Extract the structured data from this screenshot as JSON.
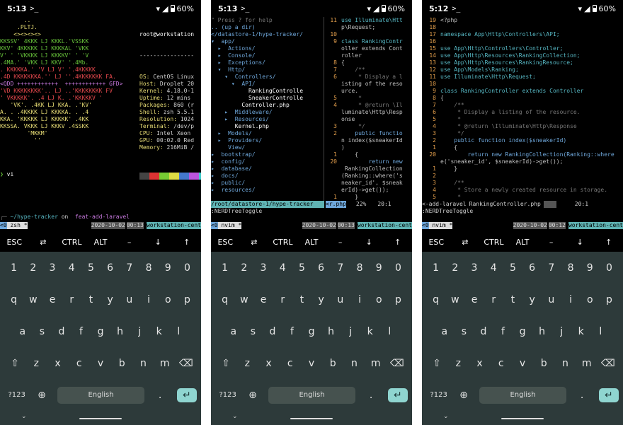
{
  "status_bar": [
    {
      "time": "5:13",
      "prompt_icon": ">_",
      "battery": "60%"
    },
    {
      "time": "5:13",
      "prompt_icon": ">_",
      "battery": "60%"
    },
    {
      "time": "5:12",
      "prompt_icon": ">_",
      "battery": "60%"
    }
  ],
  "screen1": {
    "art": [
      "       ..",
      "     .PLTJ.",
      "    <><><><>",
      "KKSSV' 4KKK LJ KKKL.'VSSKK",
      "KKV' 4KKKKK LJ KKKKAL 'VKK",
      "V' ' 'VKKKK LJ KKKKV' ' 'V",
      ".4MA.' 'VKK LJ KKV' '.4Mb.",
      ". KKKKKA.' 'V LJ V' '.4KKKKK .",
      ".4D KKKKKKKA.'' LJ ''.4KKKKKKK FA.",
      "<QDD ++++++++++++  ++++++++++++ GFD>",
      "'VD KKKKKKKK'.. LJ ..'KKKKKKKK FV",
      "' VKKKKK'. .4 LJ K. .'KKKKKV '",
      "   'VK'. .4KK LJ KKA. .'KV'",
      "A. . .4KKKK LJ KKKKA. . .4",
      "KKA. 'KKKKK LJ KKKKK' .4KK",
      "KKSSA. VKKK LJ KKKV .4SSKK",
      "        'MKKM'",
      "          ''"
    ],
    "sysinfo_title": "root@workstation",
    "sysinfo_sep": "----------------",
    "sysinfo": [
      {
        "k": "OS:",
        "v": " CentOS Linux"
      },
      {
        "k": "Host:",
        "v": " Droplet 20"
      },
      {
        "k": "Kernel:",
        "v": " 4.18.0-1"
      },
      {
        "k": "Uptime:",
        "v": " 12 mins"
      },
      {
        "k": "Packages:",
        "v": " 860 (r"
      },
      {
        "k": "Shell:",
        "v": " zsh 5.5.1"
      },
      {
        "k": "Resolution:",
        "v": " 1024"
      },
      {
        "k": "Terminal:",
        "v": " /dev/p"
      },
      {
        "k": "CPU:",
        "v": " Intel Xeon"
      },
      {
        "k": "GPU:",
        "v": " 00:02.0 Red"
      },
      {
        "k": "Memory:",
        "v": " 216MiB /"
      }
    ],
    "cmd1": "vi",
    "path": "~/hype-tracker",
    "on": " on ",
    "branch": " feat-add-laravel",
    "prompt_arrow": "❯",
    "tmux": {
      "idx": "<0",
      "win": " zsh *",
      "date": "2020-10-02",
      "time": "00:13",
      "host": "workstation-cent"
    }
  },
  "screen2": {
    "tree": [
      {
        "t": "\" Press ? for help",
        "c": "dim"
      },
      {
        "t": "",
        "c": ""
      },
      {
        "t": ".. (up a dir)",
        "c": "blu"
      },
      {
        "t": "</datastore-1/hype-tracker/",
        "c": "blu"
      },
      {
        "t": "▾  app/",
        "c": "blu"
      },
      {
        "t": "  ▸  Actions/",
        "c": "blu"
      },
      {
        "t": "  ▸  Console/",
        "c": "blu"
      },
      {
        "t": "  ▸  Exceptions/",
        "c": "blu"
      },
      {
        "t": "  ▾  Http/",
        "c": "blu"
      },
      {
        "t": "    ▾  Controllers/",
        "c": "blu"
      },
      {
        "t": "      ▾  API/",
        "c": "blu"
      },
      {
        "t": "           RankingControlle",
        "c": "wht"
      },
      {
        "t": "           SneakerControlle",
        "c": "wht"
      },
      {
        "t": "         Controller.php",
        "c": "wht"
      },
      {
        "t": "    ▸  Middleware/",
        "c": "blu"
      },
      {
        "t": "    ▸  Resources/",
        "c": "blu"
      },
      {
        "t": "       Kernel.php",
        "c": "wht"
      },
      {
        "t": "  ▸  Models/",
        "c": "blu"
      },
      {
        "t": "  ▸  Providers/",
        "c": "blu"
      },
      {
        "t": "     View/",
        "c": "blu"
      },
      {
        "t": "▸  bootstrap/",
        "c": "blu"
      },
      {
        "t": "▸  config/",
        "c": "blu"
      },
      {
        "t": "▸  database/",
        "c": "blu"
      },
      {
        "t": "▸  docs/",
        "c": "blu"
      },
      {
        "t": "▸  public/",
        "c": "blu"
      },
      {
        "t": "▸  resources/",
        "c": "blu"
      }
    ],
    "code": [
      {
        "n": "11",
        "t": "use Illuminate\\Htt"
      },
      {
        "n": "",
        "t": "p\\Request;"
      },
      {
        "n": "10",
        "t": ""
      },
      {
        "n": "9",
        "t": "class RankingContr"
      },
      {
        "n": "",
        "t": "oller extends Cont"
      },
      {
        "n": "",
        "t": "roller"
      },
      {
        "n": "8",
        "t": "{"
      },
      {
        "n": "7",
        "t": "    /**"
      },
      {
        "n": "6",
        "t": "     * Display a l"
      },
      {
        "n": "",
        "t": "isting of the reso"
      },
      {
        "n": "",
        "t": "urce."
      },
      {
        "n": "5",
        "t": "     *"
      },
      {
        "n": "4",
        "t": "     * @return \\Il"
      },
      {
        "n": "",
        "t": "luminate\\Http\\Resp"
      },
      {
        "n": "",
        "t": "onse"
      },
      {
        "n": "3",
        "t": "     */"
      },
      {
        "n": "2",
        "t": "    public functio"
      },
      {
        "n": "",
        "t": "n index($sneakerId"
      },
      {
        "n": "",
        "t": ")"
      },
      {
        "n": "1",
        "t": "    {"
      },
      {
        "n": "20",
        "t": "        return new"
      },
      {
        "n": "",
        "t": " RankingCollection"
      },
      {
        "n": "",
        "t": "(Ranking::where('s"
      },
      {
        "n": "",
        "t": "neaker_id', $sneak"
      },
      {
        "n": "",
        "t": "erId)->get());"
      },
      {
        "n": "1",
        "t": "    }"
      }
    ],
    "status_left": "/root/datastore-1/hype-tracker",
    "status_right": "<r.php",
    "status_pct": "22%",
    "status_pos": "20:1",
    "cmdline": ":NERDTreeToggle",
    "tmux": {
      "idx": "<0",
      "win": " nvim *",
      "date": "2020-10-02",
      "time": "00:13",
      "host": "workstation-cent"
    }
  },
  "screen3": {
    "code": [
      {
        "n": "19",
        "t": "<?php"
      },
      {
        "n": "18",
        "t": ""
      },
      {
        "n": "17",
        "t": "namespace App\\Http\\Controllers\\API;"
      },
      {
        "n": "16",
        "t": ""
      },
      {
        "n": "15",
        "t": "use App\\Http\\Controllers\\Controller;"
      },
      {
        "n": "14",
        "t": "use App\\Http\\Resources\\RankingCollection;"
      },
      {
        "n": "13",
        "t": "use App\\Http\\Resources\\RankingResource;"
      },
      {
        "n": "12",
        "t": "use App\\Models\\Ranking;"
      },
      {
        "n": "11",
        "t": "use Illuminate\\Http\\Request;"
      },
      {
        "n": "10",
        "t": ""
      },
      {
        "n": "9",
        "t": "class RankingController extends Controller"
      },
      {
        "n": "8",
        "t": "{"
      },
      {
        "n": "7",
        "t": "    /**"
      },
      {
        "n": "6",
        "t": "     * Display a listing of the resource."
      },
      {
        "n": "5",
        "t": "     *"
      },
      {
        "n": "4",
        "t": "     * @return \\Illuminate\\Http\\Response"
      },
      {
        "n": "3",
        "t": "     */"
      },
      {
        "n": "2",
        "t": "    public function index($sneakerId)"
      },
      {
        "n": "1",
        "t": "    {"
      },
      {
        "n": "20",
        "t": "        return new RankingCollection(Ranking::where"
      },
      {
        "n": "",
        "t": "e('sneaker_id', $sneakerId)->get());"
      },
      {
        "n": "1",
        "t": "    }"
      },
      {
        "n": "2",
        "t": ""
      },
      {
        "n": "3",
        "t": "    /**"
      },
      {
        "n": "4",
        "t": "     * Store a newly created resource in storage."
      },
      {
        "n": "5",
        "t": "     *"
      }
    ],
    "status_left": "<-add-laravel",
    "status_file": "RankingController.php",
    "status_pos": "20:1",
    "cmdline": ":NERDTreeToggle",
    "tmux": {
      "idx": "<0",
      "win": " nvim *",
      "date": "2020-10-02",
      "time": "00:12",
      "host": "workstation-cent"
    }
  },
  "extra_keys": [
    "ESC",
    "⇄",
    "CTRL",
    "ALT",
    "–",
    "↓",
    "↑"
  ],
  "keyboard": {
    "numbers": [
      "1",
      "2",
      "3",
      "4",
      "5",
      "6",
      "7",
      "8",
      "9",
      "0"
    ],
    "row1": [
      "q",
      "w",
      "e",
      "r",
      "t",
      "y",
      "u",
      "i",
      "o",
      "p"
    ],
    "row2": [
      "a",
      "s",
      "d",
      "f",
      "g",
      "h",
      "j",
      "k",
      "l"
    ],
    "row3": [
      "⇧",
      "z",
      "x",
      "c",
      "v",
      "b",
      "n",
      "m",
      "⌫"
    ],
    "sym": "?123",
    "globe": "⊕",
    "space": "English",
    "dot": ".",
    "enter": "↵"
  },
  "colors": {
    "tmux_blue": "#6fa8dc",
    "tmux_cyan": "#5fb3b3",
    "keyboard_bg": "#2d3a3a",
    "enter": "#8fd5d0"
  }
}
